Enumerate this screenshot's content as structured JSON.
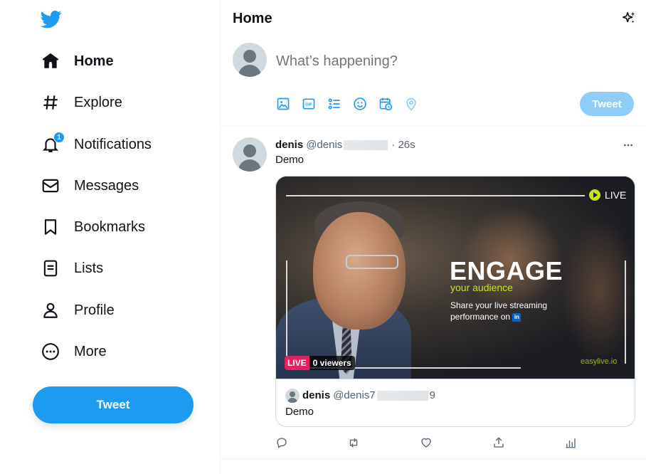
{
  "sidebar": {
    "logo": "twitter-bird-icon",
    "items": [
      {
        "label": "Home",
        "icon": "home-icon",
        "active": true
      },
      {
        "label": "Explore",
        "icon": "hashtag-icon"
      },
      {
        "label": "Notifications",
        "icon": "bell-icon",
        "badge": "1"
      },
      {
        "label": "Messages",
        "icon": "envelope-icon"
      },
      {
        "label": "Bookmarks",
        "icon": "bookmark-icon"
      },
      {
        "label": "Lists",
        "icon": "list-icon"
      },
      {
        "label": "Profile",
        "icon": "person-icon"
      },
      {
        "label": "More",
        "icon": "more-circle-icon"
      }
    ],
    "tweet_button": "Tweet"
  },
  "header": {
    "title": "Home",
    "icon": "sparkle-icon"
  },
  "composer": {
    "placeholder": "What’s happening?",
    "tools": [
      "image-icon",
      "gif-icon",
      "poll-icon",
      "emoji-icon",
      "schedule-icon",
      "location-icon"
    ],
    "tweet_button": "Tweet"
  },
  "tweet": {
    "name": "denis",
    "handle_prefix": "@denis",
    "handle_suffix": "",
    "time": "· 26s",
    "text": "Demo",
    "media": {
      "live_label": "LIVE",
      "headline": "ENGAGE",
      "subheadline": "your audience",
      "share_text": "Share your live streaming performance on",
      "linkedin": "in",
      "brand": "easylive.io",
      "live_tag": "LIVE",
      "viewers": "0 viewers"
    },
    "card": {
      "name": "denis",
      "handle_prefix": "@denis7",
      "handle_suffix": "9",
      "text": "Demo"
    },
    "actions": [
      "reply-icon",
      "retweet-icon",
      "like-icon",
      "share-icon",
      "analytics-icon"
    ]
  },
  "colors": {
    "accent": "#1d9bf0",
    "accent_disabled": "#8ecdf8",
    "live_pink": "#e0245e",
    "brand_green": "#c3e616"
  }
}
